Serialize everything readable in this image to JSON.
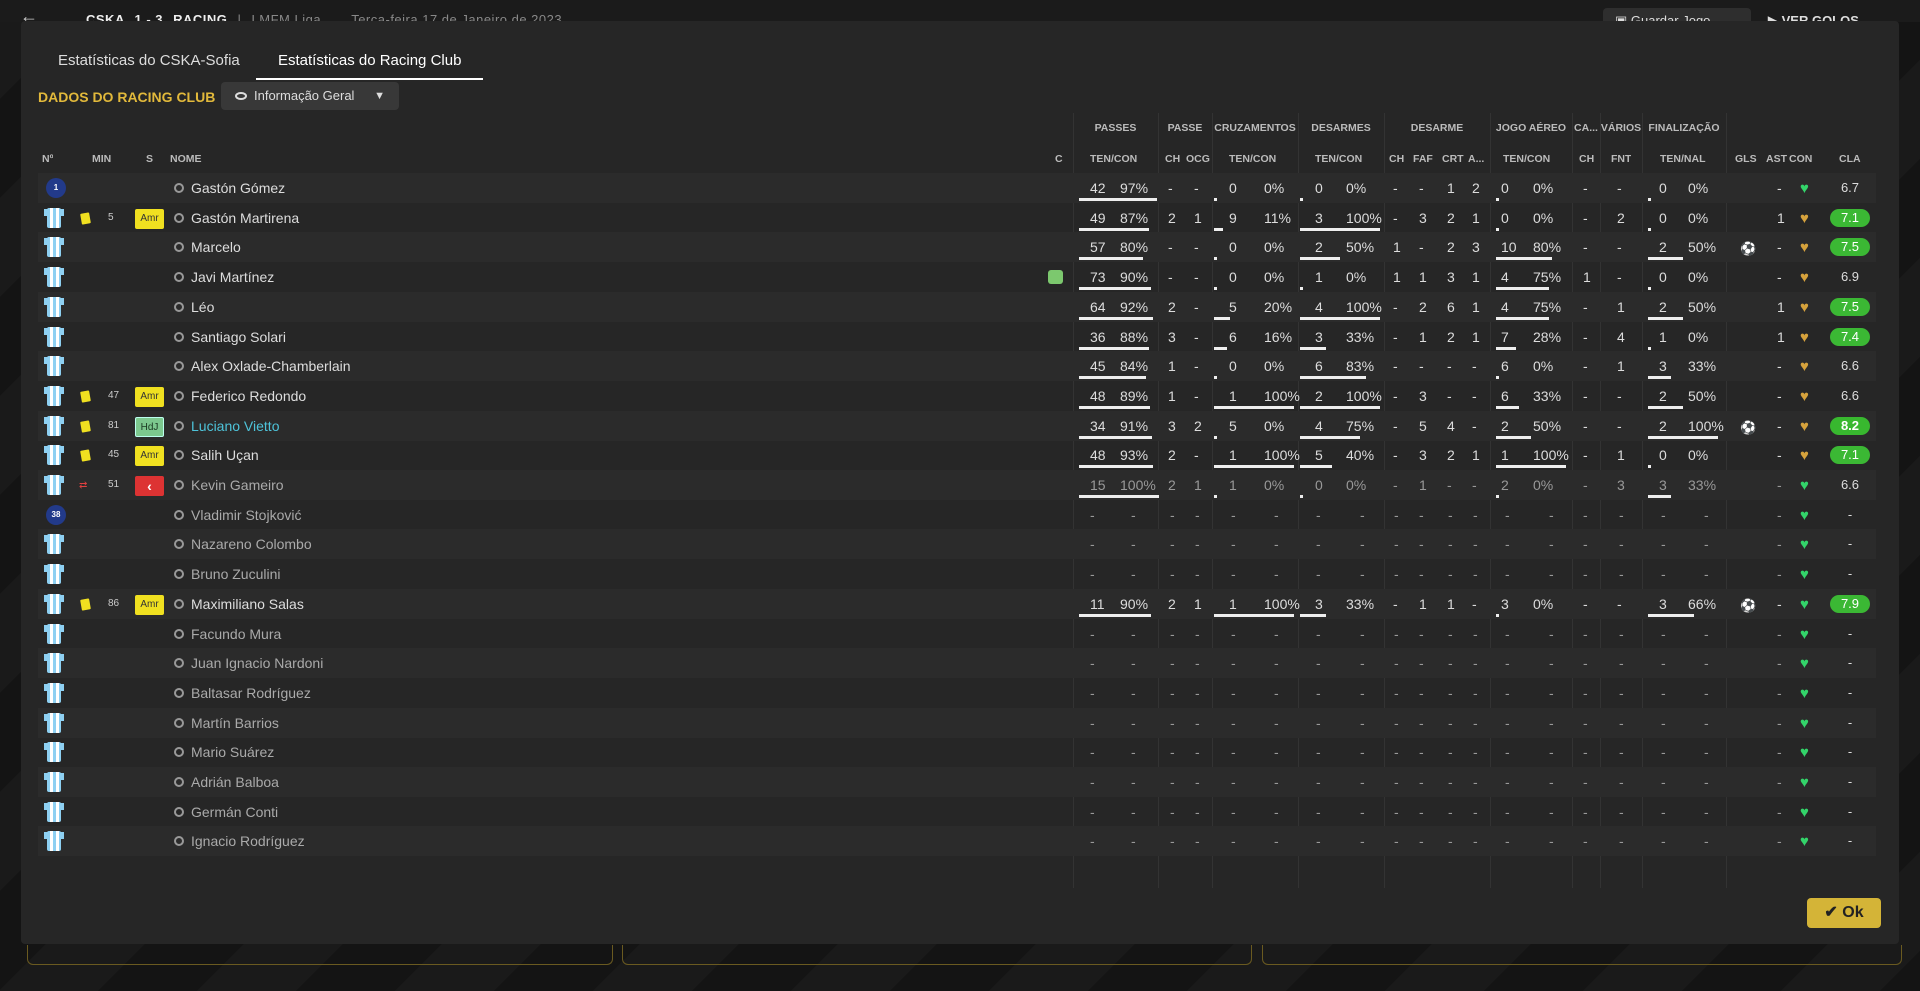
{
  "topbar": {
    "back": "←",
    "home": "CSKA",
    "score": "1 - 3",
    "away": "RACING",
    "league": "LMFM Liga",
    "date": "Terça-feira 17 de Janeiro de 2023",
    "save": "Guardar Jogo",
    "goals": "VER GOLOS"
  },
  "tabs": [
    {
      "label": "Estatísticas do CSKA-Sofia",
      "active": false
    },
    {
      "label": "Estatísticas do Racing Club",
      "active": true
    }
  ],
  "section_title": "DADOS DO RACING CLUB",
  "view_dropdown": {
    "label": "Informação Geral"
  },
  "groups": [
    "PASSES",
    "PASSE",
    "CRUZAMENTOS",
    "DESARMES",
    "DESARME",
    "JOGO AÉREO",
    "CA...",
    "VÁRIOS",
    "FINALIZAÇÃO"
  ],
  "columns": [
    "Nº",
    "MIN",
    "S",
    "NOME",
    "C",
    "TEN/CON",
    "CH",
    "OCG",
    "TEN/CON",
    "TEN/CON",
    "CH",
    "FAF",
    "CRT",
    "A...",
    "TEN/CON",
    "CH",
    "FNT",
    "TEN/NAL",
    "GLS",
    "AST",
    "CON",
    "CLA"
  ],
  "colors": {
    "accent": "#e2b93b",
    "highlight": "#4ec3d9",
    "rating_green": "#3bb834",
    "heart_green": "#33d46a",
    "heart_gold": "#d6a23c"
  },
  "players": [
    {
      "num": "1",
      "min": "",
      "card": false,
      "status": "",
      "name": "Gastón Gómez",
      "kit": "gk",
      "c": false,
      "pas": [
        "42",
        "97%"
      ],
      "p2": [
        "-",
        "-"
      ],
      "cru": [
        "0",
        "0%"
      ],
      "des": [
        "0",
        "0%"
      ],
      "d2": [
        "-",
        "-",
        "1",
        "2"
      ],
      "aer": [
        "0",
        "0%"
      ],
      "ca": "-",
      "fnt": "-",
      "fin": [
        "0",
        "0%"
      ],
      "gls": "",
      "ast": "-",
      "con": "green",
      "cla": "6.7",
      "claStyle": ""
    },
    {
      "num": "",
      "min": "5",
      "card": true,
      "status": "Amr",
      "name": "Gastón Martirena",
      "kit": "shirt",
      "c": false,
      "pas": [
        "49",
        "87%"
      ],
      "p2": [
        "2",
        "1"
      ],
      "cru": [
        "9",
        "11%"
      ],
      "des": [
        "3",
        "100%"
      ],
      "d2": [
        "-",
        "3",
        "2",
        "1"
      ],
      "aer": [
        "0",
        "0%"
      ],
      "ca": "-",
      "fnt": "2",
      "fin": [
        "0",
        "0%"
      ],
      "gls": "",
      "ast": "1",
      "con": "gold",
      "cla": "7.1",
      "claStyle": "g"
    },
    {
      "num": "",
      "min": "",
      "card": false,
      "status": "",
      "name": "Marcelo",
      "kit": "shirt",
      "c": false,
      "pas": [
        "57",
        "80%"
      ],
      "p2": [
        "-",
        "-"
      ],
      "cru": [
        "0",
        "0%"
      ],
      "des": [
        "2",
        "50%"
      ],
      "d2": [
        "1",
        "-",
        "2",
        "3"
      ],
      "aer": [
        "10",
        "80%"
      ],
      "ca": "-",
      "fnt": "-",
      "fin": [
        "2",
        "50%"
      ],
      "gls": "ball",
      "ast": "-",
      "con": "gold",
      "cla": "7.5",
      "claStyle": "g"
    },
    {
      "num": "",
      "min": "",
      "card": false,
      "status": "",
      "name": "Javi Martínez",
      "kit": "shirt",
      "c": true,
      "pas": [
        "73",
        "90%"
      ],
      "p2": [
        "-",
        "-"
      ],
      "cru": [
        "0",
        "0%"
      ],
      "des": [
        "1",
        "0%"
      ],
      "d2": [
        "1",
        "1",
        "3",
        "1"
      ],
      "aer": [
        "4",
        "75%"
      ],
      "ca": "1",
      "fnt": "-",
      "fin": [
        "0",
        "0%"
      ],
      "gls": "",
      "ast": "-",
      "con": "gold",
      "cla": "6.9",
      "claStyle": ""
    },
    {
      "num": "",
      "min": "",
      "card": false,
      "status": "",
      "name": "Léo",
      "kit": "shirt",
      "c": false,
      "pas": [
        "64",
        "92%"
      ],
      "p2": [
        "2",
        "-"
      ],
      "cru": [
        "5",
        "20%"
      ],
      "des": [
        "4",
        "100%"
      ],
      "d2": [
        "-",
        "2",
        "6",
        "1"
      ],
      "aer": [
        "4",
        "75%"
      ],
      "ca": "-",
      "fnt": "1",
      "fin": [
        "2",
        "50%"
      ],
      "gls": "",
      "ast": "1",
      "con": "gold",
      "cla": "7.5",
      "claStyle": "g"
    },
    {
      "num": "",
      "min": "",
      "card": false,
      "status": "",
      "name": "Santiago Solari",
      "kit": "shirt",
      "c": false,
      "pas": [
        "36",
        "88%"
      ],
      "p2": [
        "3",
        "-"
      ],
      "cru": [
        "6",
        "16%"
      ],
      "des": [
        "3",
        "33%"
      ],
      "d2": [
        "-",
        "1",
        "2",
        "1"
      ],
      "aer": [
        "7",
        "28%"
      ],
      "ca": "-",
      "fnt": "4",
      "fin": [
        "1",
        "0%"
      ],
      "gls": "",
      "ast": "1",
      "con": "gold",
      "cla": "7.4",
      "claStyle": "g"
    },
    {
      "num": "",
      "min": "",
      "card": false,
      "status": "",
      "name": "Alex Oxlade-Chamberlain",
      "kit": "shirt",
      "c": false,
      "pas": [
        "45",
        "84%"
      ],
      "p2": [
        "1",
        "-"
      ],
      "cru": [
        "0",
        "0%"
      ],
      "des": [
        "6",
        "83%"
      ],
      "d2": [
        "-",
        "-",
        "-",
        "-"
      ],
      "aer": [
        "6",
        "0%"
      ],
      "ca": "-",
      "fnt": "1",
      "fin": [
        "3",
        "33%"
      ],
      "gls": "",
      "ast": "-",
      "con": "gold",
      "cla": "6.6",
      "claStyle": ""
    },
    {
      "num": "",
      "min": "47",
      "card": true,
      "status": "Amr",
      "name": "Federico Redondo",
      "kit": "shirt",
      "c": false,
      "pas": [
        "48",
        "89%"
      ],
      "p2": [
        "1",
        "-"
      ],
      "cru": [
        "1",
        "100%"
      ],
      "des": [
        "2",
        "100%"
      ],
      "d2": [
        "-",
        "3",
        "-",
        "-"
      ],
      "aer": [
        "6",
        "33%"
      ],
      "ca": "-",
      "fnt": "-",
      "fin": [
        "2",
        "50%"
      ],
      "gls": "",
      "ast": "-",
      "con": "gold",
      "cla": "6.6",
      "claStyle": ""
    },
    {
      "num": "",
      "min": "81",
      "card": true,
      "status": "HdJ",
      "name": "Luciano Vietto",
      "kit": "shirt",
      "c": false,
      "hl": true,
      "pas": [
        "34",
        "91%"
      ],
      "p2": [
        "3",
        "2"
      ],
      "cru": [
        "5",
        "0%"
      ],
      "des": [
        "4",
        "75%"
      ],
      "d2": [
        "-",
        "5",
        "4",
        "-"
      ],
      "aer": [
        "2",
        "50%"
      ],
      "ca": "-",
      "fnt": "-",
      "fin": [
        "2",
        "100%"
      ],
      "gls": "ball",
      "ast": "-",
      "con": "gold",
      "cla": "8.2",
      "claStyle": "b"
    },
    {
      "num": "",
      "min": "45",
      "card": true,
      "status": "Amr",
      "name": "Salih Uçan",
      "kit": "shirt",
      "c": false,
      "pas": [
        "48",
        "93%"
      ],
      "p2": [
        "2",
        "-"
      ],
      "cru": [
        "1",
        "100%"
      ],
      "des": [
        "5",
        "40%"
      ],
      "d2": [
        "-",
        "3",
        "2",
        "1"
      ],
      "aer": [
        "1",
        "100%"
      ],
      "ca": "-",
      "fnt": "1",
      "fin": [
        "0",
        "0%"
      ],
      "gls": "",
      "ast": "-",
      "con": "gold",
      "cla": "7.1",
      "claStyle": "g"
    },
    {
      "num": "",
      "min": "51",
      "card": false,
      "sub": true,
      "status": "out",
      "name": "Kevin Gameiro",
      "kit": "shirt",
      "c": false,
      "pas": [
        "15",
        "100%"
      ],
      "p2": [
        "2",
        "1"
      ],
      "cru": [
        "1",
        "0%"
      ],
      "des": [
        "0",
        "0%"
      ],
      "d2": [
        "-",
        "1",
        "-",
        "-"
      ],
      "aer": [
        "2",
        "0%"
      ],
      "ca": "-",
      "fnt": "3",
      "fin": [
        "3",
        "33%"
      ],
      "gls": "",
      "ast": "-",
      "con": "green",
      "cla": "6.6",
      "claStyle": ""
    },
    {
      "num": "38",
      "min": "",
      "card": false,
      "sub": true,
      "status": "",
      "name": "Vladimir Stojković",
      "kit": "gk",
      "c": false,
      "empty": true,
      "con": "green",
      "cla": "-"
    },
    {
      "num": "",
      "min": "",
      "card": false,
      "sub": true,
      "status": "",
      "name": "Nazareno Colombo",
      "kit": "shirt",
      "c": false,
      "empty": true,
      "con": "green",
      "cla": "-"
    },
    {
      "num": "",
      "min": "",
      "card": false,
      "sub": true,
      "status": "",
      "name": "Bruno Zuculini",
      "kit": "shirt",
      "c": false,
      "empty": true,
      "con": "green",
      "cla": "-"
    },
    {
      "num": "",
      "min": "86",
      "card": true,
      "status": "Amr",
      "name": "Maximiliano Salas",
      "kit": "shirt",
      "c": false,
      "pas": [
        "11",
        "90%"
      ],
      "p2": [
        "2",
        "1"
      ],
      "cru": [
        "1",
        "100%"
      ],
      "des": [
        "3",
        "33%"
      ],
      "d2": [
        "-",
        "1",
        "1",
        "-"
      ],
      "aer": [
        "3",
        "0%"
      ],
      "ca": "-",
      "fnt": "-",
      "fin": [
        "3",
        "66%"
      ],
      "gls": "ball",
      "ast": "-",
      "con": "green",
      "cla": "7.9",
      "claStyle": "g"
    },
    {
      "num": "",
      "min": "",
      "card": false,
      "sub": true,
      "status": "",
      "name": "Facundo Mura",
      "kit": "shirt",
      "c": false,
      "empty": true,
      "con": "green",
      "cla": "-"
    },
    {
      "num": "",
      "min": "",
      "card": false,
      "sub": true,
      "status": "",
      "name": "Juan Ignacio Nardoni",
      "kit": "shirt",
      "c": false,
      "empty": true,
      "con": "green",
      "cla": "-"
    },
    {
      "num": "",
      "min": "",
      "card": false,
      "sub": true,
      "status": "",
      "name": "Baltasar Rodríguez",
      "kit": "shirt",
      "c": false,
      "empty": true,
      "con": "green",
      "cla": "-"
    },
    {
      "num": "",
      "min": "",
      "card": false,
      "sub": true,
      "status": "",
      "name": "Martín Barrios",
      "kit": "shirt",
      "c": false,
      "empty": true,
      "con": "green",
      "cla": "-"
    },
    {
      "num": "",
      "min": "",
      "card": false,
      "sub": true,
      "status": "",
      "name": "Mario Suárez",
      "kit": "shirt",
      "c": false,
      "empty": true,
      "con": "green",
      "cla": "-"
    },
    {
      "num": "",
      "min": "",
      "card": false,
      "sub": true,
      "status": "",
      "name": "Adrián Balboa",
      "kit": "shirt",
      "c": false,
      "empty": true,
      "con": "green",
      "cla": "-"
    },
    {
      "num": "",
      "min": "",
      "card": false,
      "sub": true,
      "status": "",
      "name": "Germán Conti",
      "kit": "shirt",
      "c": false,
      "empty": true,
      "con": "green",
      "cla": "-"
    },
    {
      "num": "",
      "min": "",
      "card": false,
      "sub": true,
      "status": "",
      "name": "Ignacio Rodríguez",
      "kit": "shirt",
      "c": false,
      "empty": true,
      "con": "green",
      "cla": "-"
    }
  ],
  "ok_button": "Ok"
}
